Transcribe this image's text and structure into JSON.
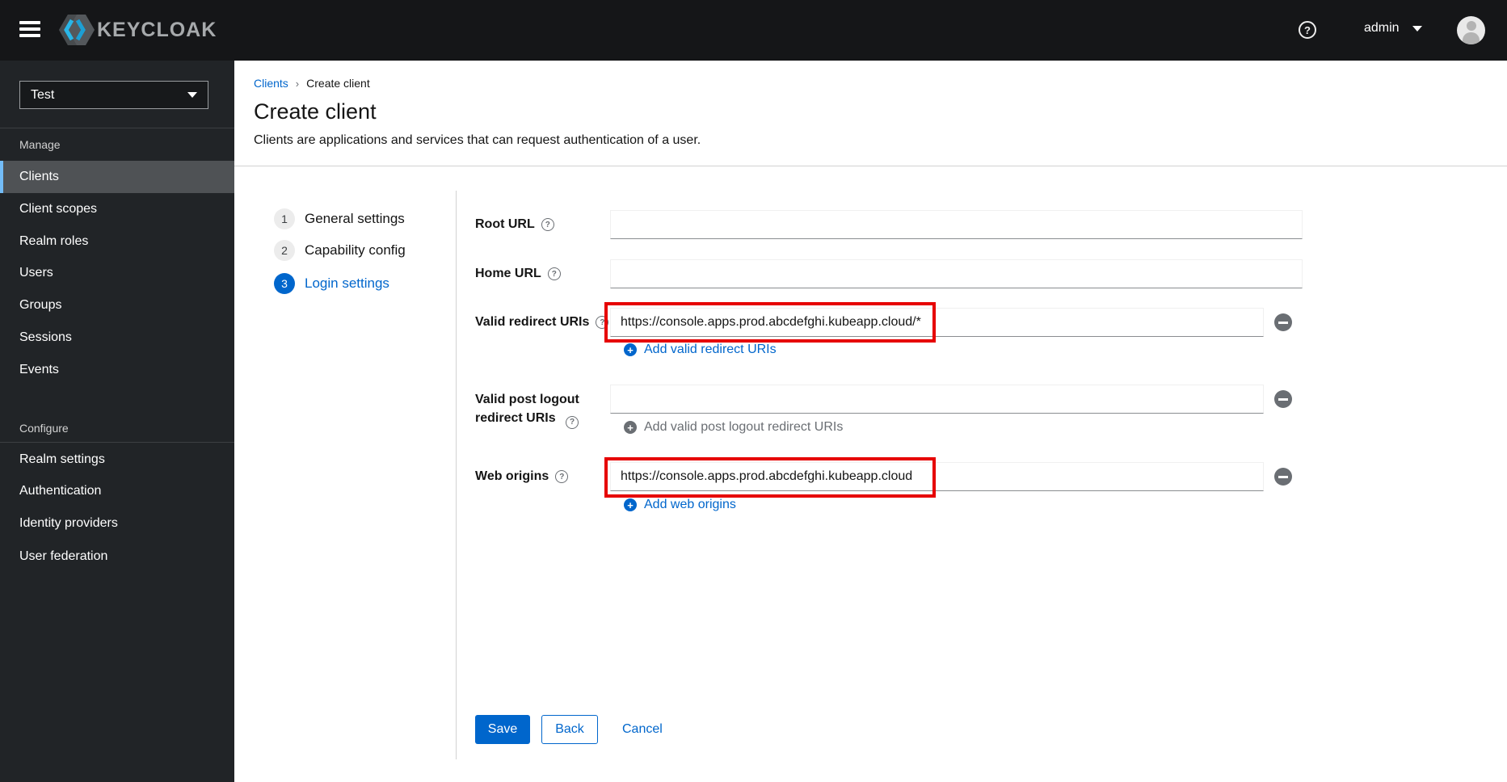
{
  "topbar": {
    "brand": "KEYCLOAK",
    "help": "?",
    "user": "admin"
  },
  "sidebar": {
    "realm": "Test",
    "sections": [
      {
        "title": "Manage",
        "items": [
          "Clients",
          "Client scopes",
          "Realm roles",
          "Users",
          "Groups",
          "Sessions",
          "Events"
        ],
        "active_item": "Clients"
      },
      {
        "title": "Configure",
        "items": [
          "Realm settings",
          "Authentication",
          "Identity providers",
          "User federation"
        ]
      }
    ]
  },
  "breadcrumb": {
    "parent": "Clients",
    "current": "Create client"
  },
  "page": {
    "title": "Create client",
    "subtitle": "Clients are applications and services that can request authentication of a user."
  },
  "wizard": {
    "steps": [
      {
        "num": "1",
        "label": "General settings"
      },
      {
        "num": "2",
        "label": "Capability config"
      },
      {
        "num": "3",
        "label": "Login settings"
      }
    ],
    "active_step": "Login settings"
  },
  "form": {
    "help_glyph": "?",
    "fields": [
      {
        "label": "Root URL",
        "value": ""
      },
      {
        "label": "Home URL",
        "value": ""
      },
      {
        "label": "Valid redirect URIs",
        "value": "https://console.apps.prod.abcdefghi.kubeapp.cloud/*",
        "add_label": "Add valid redirect URIs",
        "highlighted": true
      },
      {
        "label": "Valid post logout redirect URIs",
        "value": "",
        "add_label": "Add valid post logout redirect URIs",
        "add_disabled": true
      },
      {
        "label": "Web origins",
        "value": "https://console.apps.prod.abcdefghi.kubeapp.cloud",
        "add_label": "Add web origins",
        "highlighted": true
      }
    ],
    "actions": {
      "save": "Save",
      "back": "Back",
      "cancel": "Cancel"
    }
  },
  "colors": {
    "accent_blue": "#0066cc",
    "nav_active_accent": "#73bcf7",
    "annotation_red": "#e60000",
    "topbar_bg": "#151618",
    "sidebar_bg": "#212427"
  }
}
